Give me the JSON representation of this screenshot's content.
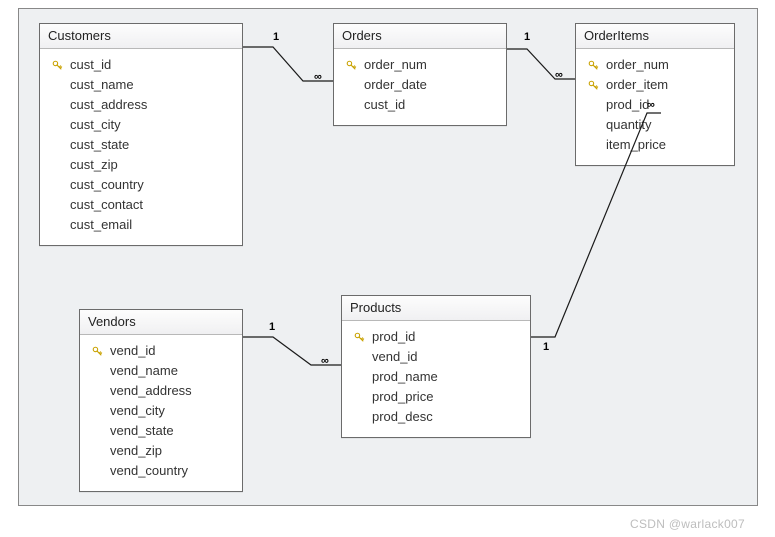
{
  "watermark": "CSDN @warlack007",
  "entities": {
    "customers": {
      "title": "Customers",
      "fields": [
        {
          "name": "cust_id",
          "pk": true
        },
        {
          "name": "cust_name",
          "pk": false
        },
        {
          "name": "cust_address",
          "pk": false
        },
        {
          "name": "cust_city",
          "pk": false
        },
        {
          "name": "cust_state",
          "pk": false
        },
        {
          "name": "cust_zip",
          "pk": false
        },
        {
          "name": "cust_country",
          "pk": false
        },
        {
          "name": "cust_contact",
          "pk": false
        },
        {
          "name": "cust_email",
          "pk": false
        }
      ]
    },
    "orders": {
      "title": "Orders",
      "fields": [
        {
          "name": "order_num",
          "pk": true
        },
        {
          "name": "order_date",
          "pk": false
        },
        {
          "name": "cust_id",
          "pk": false
        }
      ]
    },
    "orderitems": {
      "title": "OrderItems",
      "fields": [
        {
          "name": "order_num",
          "pk": true
        },
        {
          "name": "order_item",
          "pk": true
        },
        {
          "name": "prod_id",
          "pk": false
        },
        {
          "name": "quantity",
          "pk": false
        },
        {
          "name": "item_price",
          "pk": false
        }
      ]
    },
    "vendors": {
      "title": "Vendors",
      "fields": [
        {
          "name": "vend_id",
          "pk": true
        },
        {
          "name": "vend_name",
          "pk": false
        },
        {
          "name": "vend_address",
          "pk": false
        },
        {
          "name": "vend_city",
          "pk": false
        },
        {
          "name": "vend_state",
          "pk": false
        },
        {
          "name": "vend_zip",
          "pk": false
        },
        {
          "name": "vend_country",
          "pk": false
        }
      ]
    },
    "products": {
      "title": "Products",
      "fields": [
        {
          "name": "prod_id",
          "pk": true
        },
        {
          "name": "vend_id",
          "pk": false
        },
        {
          "name": "prod_name",
          "pk": false
        },
        {
          "name": "prod_price",
          "pk": false
        },
        {
          "name": "prod_desc",
          "pk": false
        }
      ]
    }
  },
  "relationships": [
    {
      "from": "customers",
      "to": "orders",
      "from_card": "1",
      "to_card": "∞"
    },
    {
      "from": "orders",
      "to": "orderitems",
      "from_card": "1",
      "to_card": "∞"
    },
    {
      "from": "vendors",
      "to": "products",
      "from_card": "1",
      "to_card": "∞"
    },
    {
      "from": "products",
      "to": "orderitems",
      "from_card": "1",
      "to_card": "∞"
    }
  ],
  "cards": {
    "c_o_1": "1",
    "c_o_inf": "∞",
    "o_oi_1": "1",
    "o_oi_inf": "∞",
    "v_p_1": "1",
    "v_p_inf": "∞",
    "p_oi_1": "1",
    "p_oi_inf": "∞"
  }
}
